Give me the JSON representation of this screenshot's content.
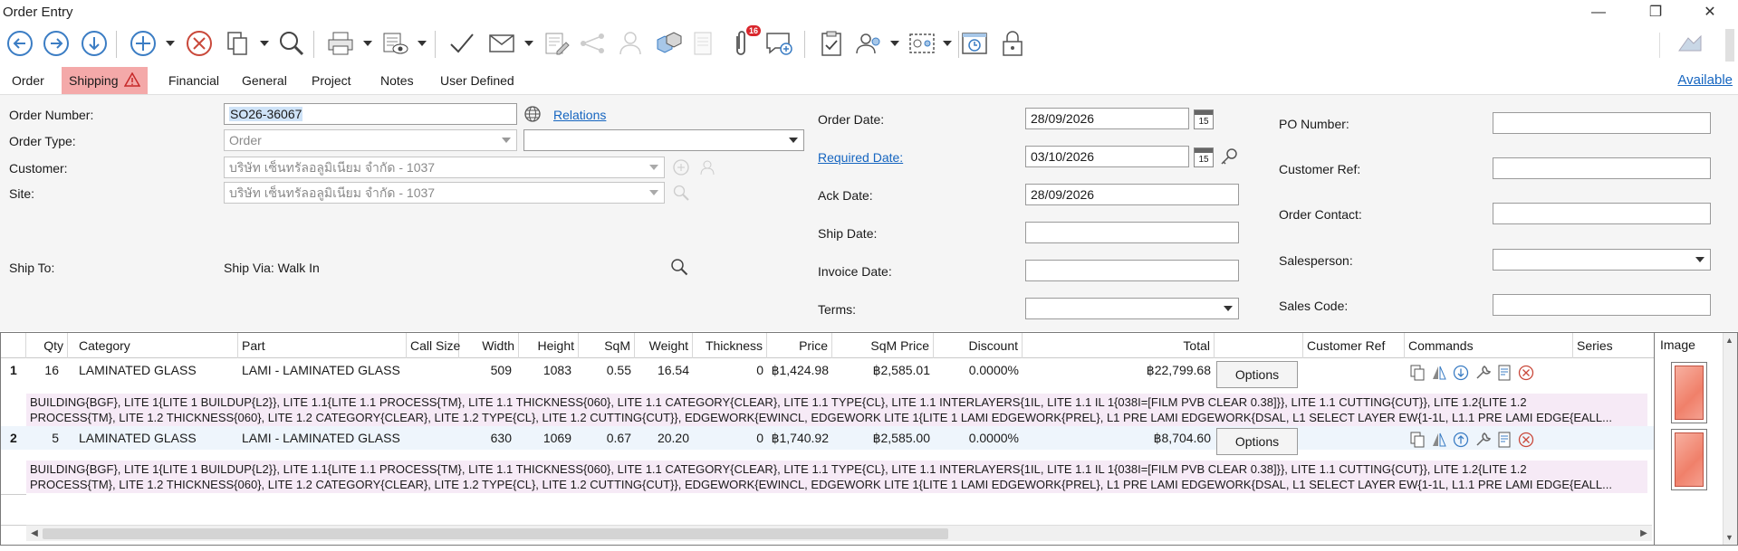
{
  "window": {
    "title": "Order Entry",
    "minimize": "—",
    "restore": "❐",
    "close": "✕"
  },
  "toolbar": {
    "notification_count": "16"
  },
  "tabs": [
    {
      "label": "Order"
    },
    {
      "label": "Shipping"
    },
    {
      "label": "Financial"
    },
    {
      "label": "General"
    },
    {
      "label": "Project"
    },
    {
      "label": "Notes"
    },
    {
      "label": "User Defined"
    }
  ],
  "available_link": "Available",
  "form": {
    "order_number_label": "Order Number:",
    "order_number_value": "SO26-36067",
    "relations_link": "Relations",
    "order_type_label": "Order Type:",
    "order_type_value": "Order",
    "order_type_sub_value": "",
    "customer_label": "Customer:",
    "customer_value": "บริษัท เซ็นทรัลอลูมิเนียม  จำกัด - 1037",
    "site_label": "Site:",
    "site_value": "บริษัท เซ็นทรัลอลูมิเนียม  จำกัด - 1037",
    "ship_to_label": "Ship To:",
    "ship_via_text": "Ship Via: Walk In",
    "order_date_label": "Order Date:",
    "order_date_value": "28/09/2026",
    "required_date_label": "Required Date:",
    "required_date_value": "03/10/2026",
    "ack_date_label": "Ack Date:",
    "ack_date_value": "28/09/2026",
    "ship_date_label": "Ship Date:",
    "ship_date_value": "",
    "invoice_date_label": "Invoice Date:",
    "invoice_date_value": "",
    "terms_label": "Terms:",
    "terms_value": "",
    "calendar_day": "15",
    "po_number_label": "PO Number:",
    "po_number_value": "",
    "customer_ref_label": "Customer Ref:",
    "customer_ref_value": "",
    "order_contact_label": "Order Contact:",
    "order_contact_value": "",
    "salesperson_label": "Salesperson:",
    "salesperson_value": "",
    "sales_code_label": "Sales Code:",
    "sales_code_value": ""
  },
  "grid": {
    "columns": {
      "qty": "Qty",
      "category": "Category",
      "part": "Part",
      "call_size": "Call Size",
      "width": "Width",
      "height": "Height",
      "sqm": "SqM",
      "weight": "Weight",
      "thickness": "Thickness",
      "price": "Price",
      "sqm_price": "SqM Price",
      "discount": "Discount",
      "total": "Total",
      "customer_ref": "Customer Ref",
      "commands": "Commands",
      "series": "Series"
    },
    "options_label": "Options",
    "rows": [
      {
        "num": "1",
        "qty": "16",
        "category": "LAMINATED GLASS",
        "part": "LAMI - LAMINATED GLASS",
        "width": "509",
        "height": "1083",
        "sqm": "0.55",
        "weight": "16.54",
        "thickness": "0",
        "price": "฿1,424.98",
        "sqm_price": "฿2,585.01",
        "discount": "0.0000%",
        "total": "฿22,799.68",
        "desc1": "BUILDING{BGF}, LITE 1{LITE 1 BUILDUP{L2}}, LITE 1.1{LITE 1.1 PROCESS{TM}, LITE 1.1 THICKNESS{060}, LITE 1.1 CATEGORY{CLEAR}, LITE 1.1 TYPE{CL}, LITE 1.1 INTERLAYERS{1IL, LITE 1.1 IL 1{038I=[FILM PVB CLEAR 0.38]}}, LITE 1.1 CUTTING{CUT}}, LITE 1.2{LITE 1.2",
        "desc2": "PROCESS{TM}, LITE 1.2 THICKNESS{060}, LITE 1.2 CATEGORY{CLEAR}, LITE 1.2 TYPE{CL}, LITE 1.2 CUTTING{CUT}}, EDGEWORK{EWINCL, EDGEWORK LITE 1{LITE 1 LAMI EDGEWORK{PREL}, L1 PRE LAMI EDGEWORK{DSAL, L1 SELECT LAYER EW{1-1L, L1.1 PRE LAMI EDGE{EALL..."
      },
      {
        "num": "2",
        "qty": "5",
        "category": "LAMINATED GLASS",
        "part": "LAMI - LAMINATED GLASS",
        "width": "630",
        "height": "1069",
        "sqm": "0.67",
        "weight": "20.20",
        "thickness": "0",
        "price": "฿1,740.92",
        "sqm_price": "฿2,585.00",
        "discount": "0.0000%",
        "total": "฿8,704.60",
        "desc1": "BUILDING{BGF}, LITE 1{LITE 1 BUILDUP{L2}}, LITE 1.1{LITE 1.1 PROCESS{TM}, LITE 1.1 THICKNESS{060}, LITE 1.1 CATEGORY{CLEAR}, LITE 1.1 TYPE{CL}, LITE 1.1 INTERLAYERS{1IL, LITE 1.1 IL 1{038I=[FILM PVB CLEAR 0.38]}}, LITE 1.1 CUTTING{CUT}}, LITE 1.2{LITE 1.2",
        "desc2": "PROCESS{TM}, LITE 1.2 THICKNESS{060}, LITE 1.2 CATEGORY{CLEAR}, LITE 1.2 TYPE{CL}, LITE 1.2 CUTTING{CUT}}, EDGEWORK{EWINCL, EDGEWORK LITE 1{LITE 1 LAMI EDGEWORK{PREL}, L1 PRE LAMI EDGEWORK{DSAL, L1 SELECT LAYER EW{1-1L, L1.1 PRE LAMI EDGE{EALL..."
      }
    ]
  },
  "image_pane": {
    "header": "Image"
  },
  "colors": {
    "accent_tab": "#f4a9a9",
    "link": "#1565c0",
    "icon_blue": "#3b7dc4",
    "desc_bg": "#f6eaf6"
  }
}
